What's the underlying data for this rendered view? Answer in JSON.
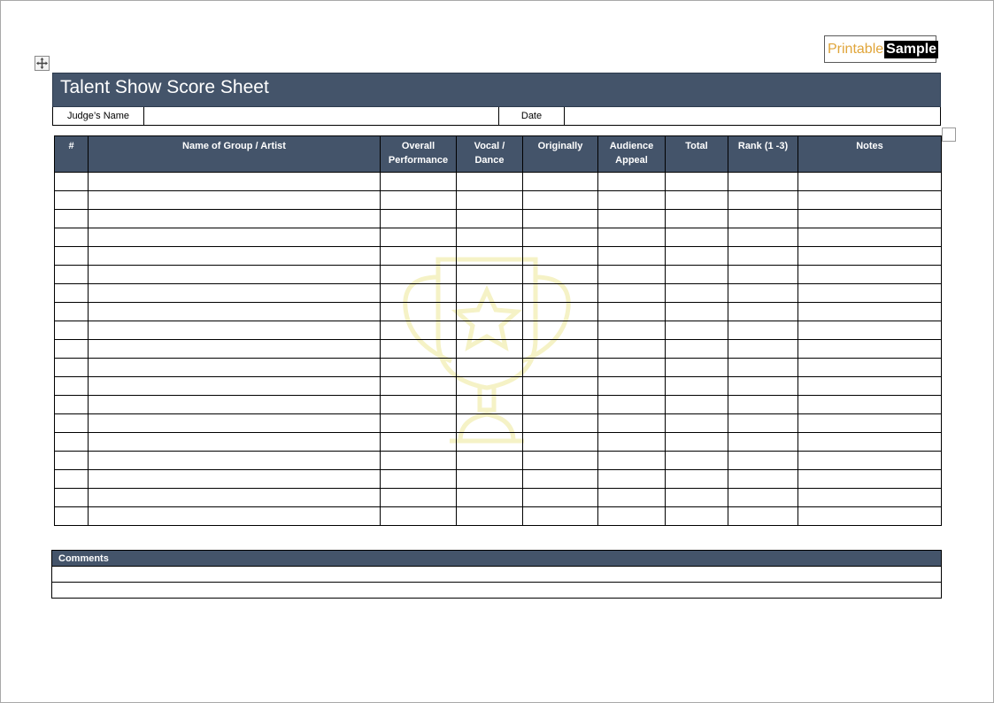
{
  "logo": {
    "part1": "Printable",
    "part2": "Sample"
  },
  "title": "Talent Show Score Sheet",
  "judge": {
    "name_label": "Judge’s Name",
    "name_value": "",
    "date_label": "Date",
    "date_value": ""
  },
  "score_table": {
    "columns": [
      "#",
      "Name of Group / Artist",
      "Overall Performance",
      "Vocal / Dance",
      "Originally",
      "Audience Appeal",
      "Total",
      "Rank (1 -3)",
      "Notes"
    ],
    "row_count": 19
  },
  "comments": {
    "label": "Comments",
    "row_count": 2
  },
  "colors": {
    "header_bg": "#44546a",
    "logo_accent": "#e0a53a",
    "watermark": "#f5f2c6"
  },
  "icons": {
    "move_handle": "move-arrows-icon",
    "watermark": "trophy-icon"
  }
}
